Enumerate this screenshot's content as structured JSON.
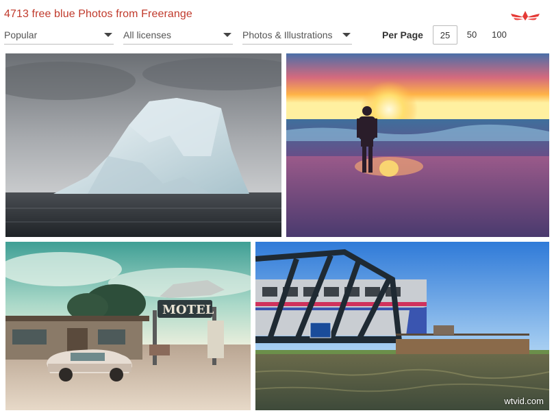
{
  "header": {
    "title": "4713 free blue Photos from Freerange"
  },
  "filters": {
    "sort": "Popular",
    "license": "All licenses",
    "type": "Photos & Illustrations"
  },
  "per_page": {
    "label": "Per Page",
    "options": [
      "25",
      "50",
      "100"
    ],
    "selected": "25"
  },
  "photos": [
    {
      "subject": "iceberg-in-sea"
    },
    {
      "subject": "man-on-beach-at-sunset"
    },
    {
      "subject": "retro-motel-sign-with-classic-car"
    },
    {
      "subject": "train-on-steel-bridge-over-water"
    }
  ],
  "watermark": "wtvid.com",
  "colors": {
    "title": "#c0392b",
    "logo": "#e53935"
  }
}
